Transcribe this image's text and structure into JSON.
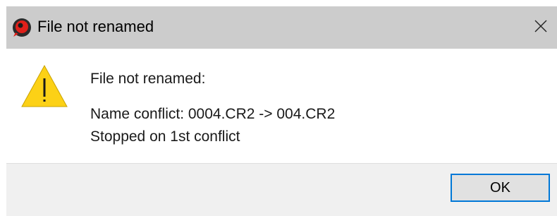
{
  "window": {
    "title": "File not renamed",
    "close_icon": "close-icon",
    "app_icon": "app-icon"
  },
  "message": {
    "icon": "warning-icon",
    "heading": "File not renamed:",
    "line1": "Name conflict: 0004.CR2 -> 004.CR2",
    "line2": "Stopped on 1st conflict"
  },
  "buttons": {
    "ok_label": "OK"
  },
  "colors": {
    "titlebar": "#cccccc",
    "footer": "#f0f0f0",
    "button_border": "#0078d7",
    "warning_yellow": "#fcd116",
    "app_icon_red": "#e0201a"
  }
}
